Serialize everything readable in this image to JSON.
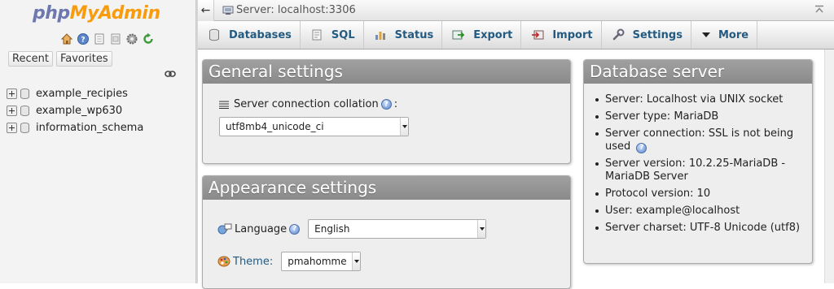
{
  "nav": {
    "logo_php": "php",
    "logo_myadmin": "MyAdmin",
    "icons": [
      "home-icon",
      "help-icon",
      "docs-icon",
      "sql-docs-icon",
      "settings-icon",
      "reload-icon"
    ],
    "tabs": [
      {
        "label": "Recent"
      },
      {
        "label": "Favorites"
      }
    ],
    "databases": [
      {
        "name": "example_recipies"
      },
      {
        "name": "example_wp630"
      },
      {
        "name": "information_schema"
      }
    ]
  },
  "topbar": {
    "back_label": "←",
    "server": "Server: localhost:3306"
  },
  "menu": {
    "tabs": [
      {
        "label": "Databases",
        "icon": "database-icon"
      },
      {
        "label": "SQL",
        "icon": "sql-icon"
      },
      {
        "label": "Status",
        "icon": "status-icon"
      },
      {
        "label": "Export",
        "icon": "export-icon"
      },
      {
        "label": "Import",
        "icon": "import-icon"
      },
      {
        "label": "Settings",
        "icon": "wrench-icon"
      },
      {
        "label": "More",
        "icon": "chevron-down-icon"
      }
    ]
  },
  "general": {
    "title": "General settings",
    "collation_label": "Server connection collation",
    "collation_suffix": ":",
    "collation_value": "utf8mb4_unicode_ci"
  },
  "appearance": {
    "title": "Appearance settings",
    "language_label": "Language",
    "language_value": "English",
    "theme_label": "Theme:",
    "theme_value": "pmahomme"
  },
  "dbserver": {
    "title": "Database server",
    "items": [
      "Server: Localhost via UNIX socket",
      "Server type: MariaDB",
      "Server connection: SSL is not being used",
      "Server version: 10.2.25-MariaDB - MariaDB Server",
      "Protocol version: 10",
      "User: example@localhost",
      "Server charset: UTF-8 Unicode (utf8)"
    ]
  },
  "colors": {
    "logo_php": "#6c78af",
    "logo_myadmin": "#f89c0e",
    "menu_text": "#235a81",
    "panel_header": "#999999"
  }
}
